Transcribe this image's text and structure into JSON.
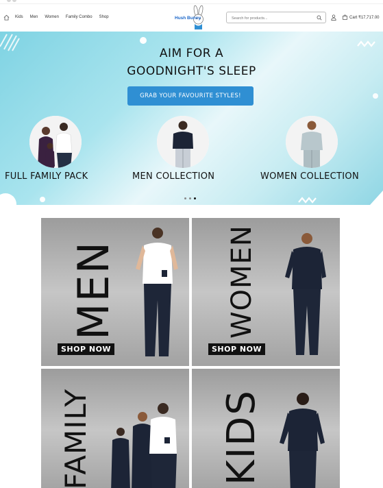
{
  "header": {
    "nav": [
      "Kids",
      "Men",
      "Women",
      "Family Combo",
      "Shop"
    ],
    "logo": "Hush Bunny",
    "search_placeholder": "Search for products...",
    "cart_label": "Cart ₹17,717.00"
  },
  "hero": {
    "title_line1": "AIM FOR A",
    "title_line2": "GOODNIGHT'S SLEEP",
    "cta": "GRAB YOUR FAVOURITE STYLES!",
    "collections": [
      "FULL FAMILY PACK",
      "MEN COLLECTION",
      "WOMEN COLLECTION"
    ],
    "slides": 3,
    "active_slide": 3
  },
  "categories": [
    {
      "word": "MEN",
      "cta": "SHOP NOW"
    },
    {
      "word": "WOMEN",
      "cta": "SHOP NOW"
    },
    {
      "word": "FAMILY",
      "cta": ""
    },
    {
      "word": "KIDS",
      "cta": ""
    }
  ],
  "colors": {
    "accent": "#2f8fd3",
    "hero_bg": "#9edbe8",
    "logo_blue": "#1a66c9"
  }
}
